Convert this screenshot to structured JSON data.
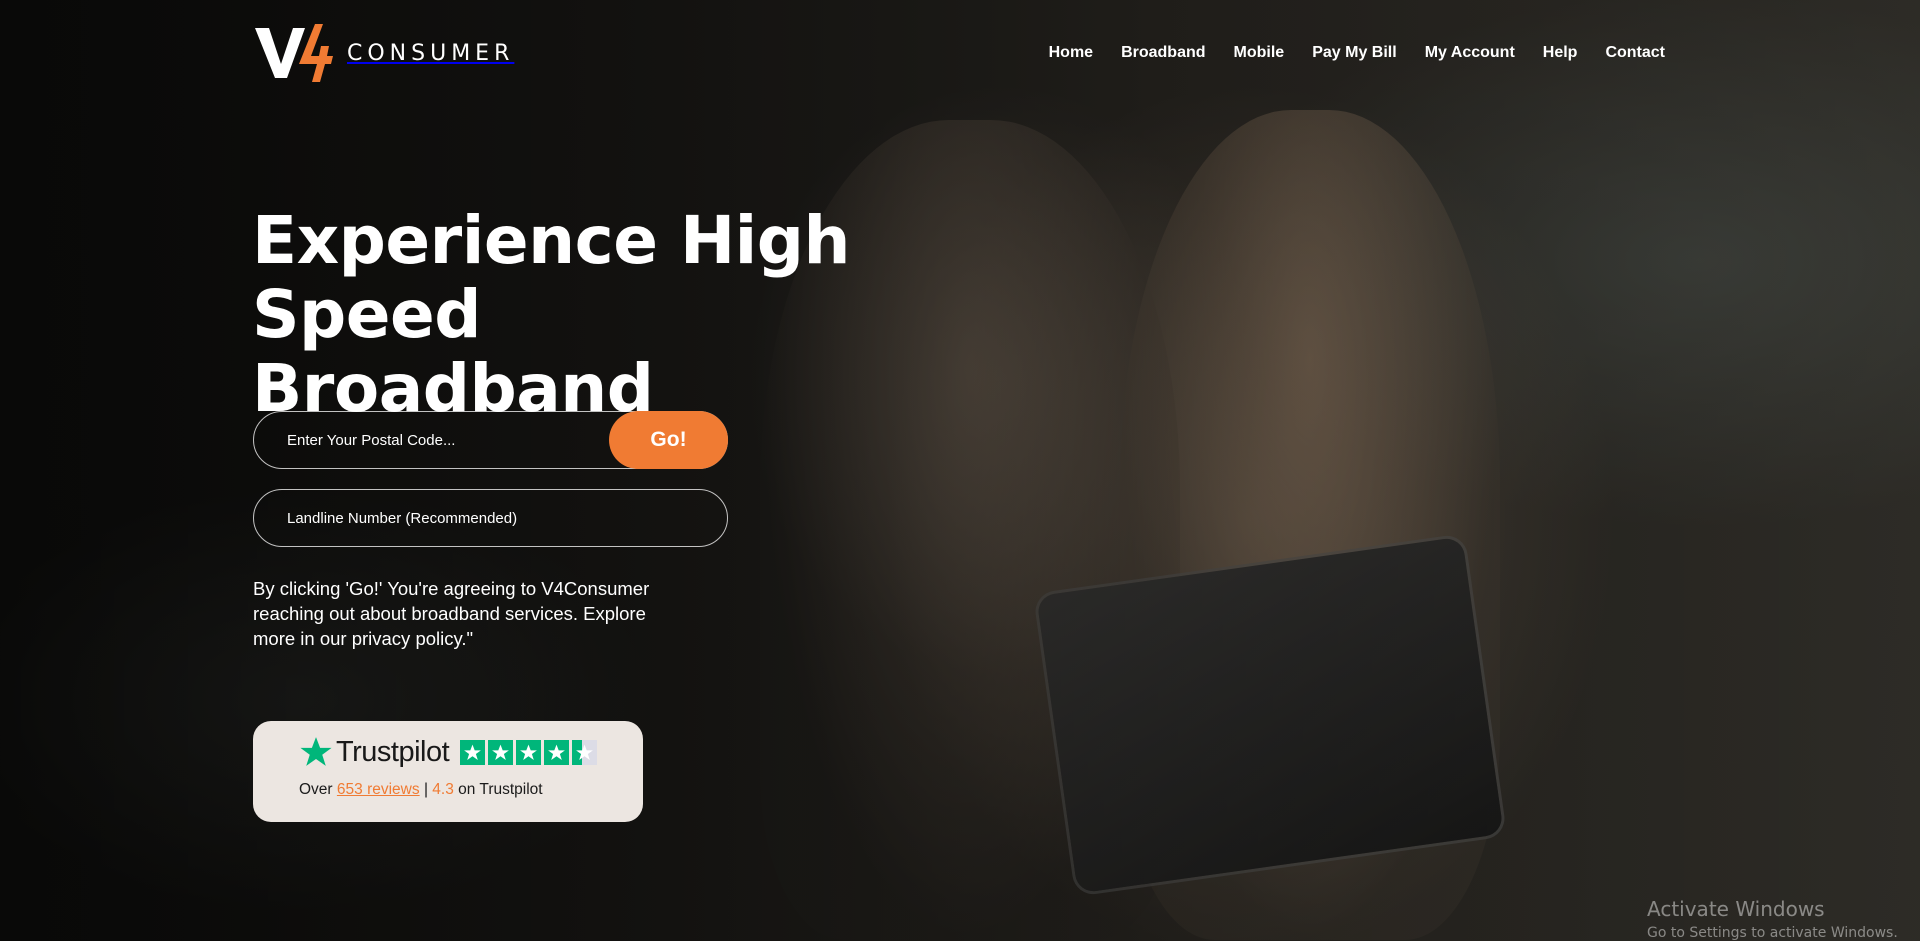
{
  "brand": {
    "logo_mark": "V4",
    "wordmark": "CONSUMER",
    "accent_color": "#f07b33"
  },
  "nav": {
    "items": [
      {
        "label": "Home"
      },
      {
        "label": "Broadband"
      },
      {
        "label": "Mobile"
      },
      {
        "label": "Pay My Bill"
      },
      {
        "label": "My Account"
      },
      {
        "label": "Help"
      },
      {
        "label": "Contact"
      }
    ]
  },
  "hero": {
    "title_line1": "Experience High",
    "title_line2": "Speed Broadband",
    "postal_placeholder": "Enter Your Postal Code...",
    "postal_value": "",
    "go_label": "Go!",
    "landline_placeholder": "Landline Number (Recommended)",
    "landline_value": "",
    "consent_text": "By clicking 'Go!' You're agreeing to V4Consumer reaching out about broadband services. Explore more in our privacy policy.\""
  },
  "trustpilot": {
    "brand": "Trustpilot",
    "rating_stars": 4.3,
    "prefix": "Over",
    "reviews_text": "653 reviews",
    "separator": "|",
    "score": "4.3",
    "suffix": "on Trustpilot",
    "star_color": "#00b67a"
  },
  "system_watermark": {
    "title": "Activate Windows",
    "subtitle": "Go to Settings to activate Windows."
  }
}
